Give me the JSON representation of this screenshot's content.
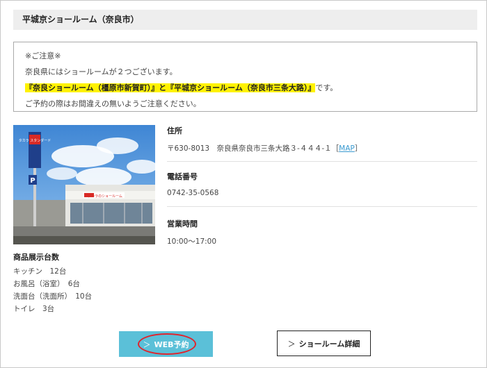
{
  "title": "平城京ショールーム（奈良市）",
  "notice": {
    "heading": "※ご注意※",
    "line1": "奈良県にはショールームが２つございます。",
    "highlight": "『奈良ショールーム（橿原市新賀町）』と『平城京ショールーム（奈良市三条大路）』",
    "line2_suffix": "です。",
    "line3": "ご予約の際はお間違えの無いようご注意ください。"
  },
  "photo": {
    "sign_logo": "タカラ スタンダード",
    "building_sign": "タカラのショールーム",
    "parking_sign": "P"
  },
  "address": {
    "label": "住所",
    "value": "〒630-8013　奈良県奈良市三条大路３-４４４-１",
    "map_link": "MAP"
  },
  "phone": {
    "label": "電話番号",
    "value": "0742-35-0568"
  },
  "hours": {
    "label": "営業時間",
    "value": "10:00～17:00"
  },
  "exhibit": {
    "heading": "商品展示台数",
    "items": [
      "キッチン　12台",
      "お風呂（浴室）　6台",
      "洗面台（洗面所）　10台",
      "トイレ　3台"
    ]
  },
  "buttons": {
    "web_reserve": "WEB予約",
    "showroom_detail": "ショールーム詳細",
    "chevron": "＞"
  },
  "colors": {
    "web_button_bg": "#5bc0d8",
    "highlight": "#fff200",
    "annotation_ellipse": "#e0242d",
    "link": "#3b9bd1"
  }
}
